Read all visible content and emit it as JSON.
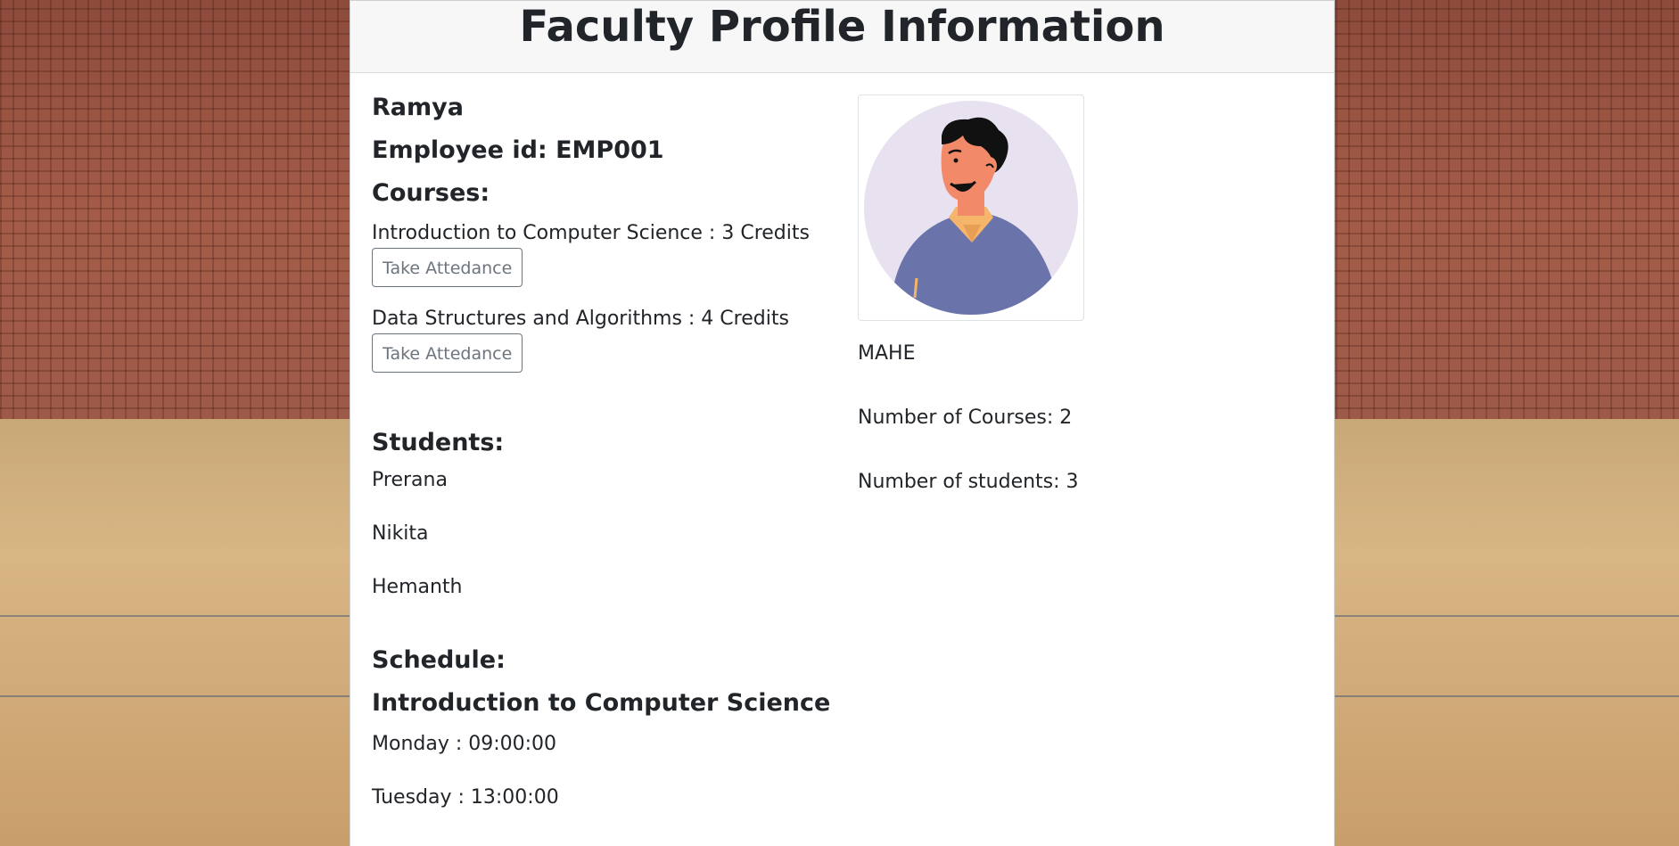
{
  "header": {
    "title": "Faculty Profile Information"
  },
  "profile": {
    "name": "Ramya",
    "employee_id": "Employee id: EMP001",
    "institution": "MAHE",
    "num_courses": "Number of Courses: 2",
    "num_students": "Number of students: 3",
    "avatar_icon": "person-avatar-icon"
  },
  "courses": {
    "heading": "Courses:",
    "items": [
      {
        "text": "Introduction to Computer Science : 3 Credits",
        "button": "Take Attedance"
      },
      {
        "text": "Data Structures and Algorithms : 4 Credits",
        "button": "Take Attedance"
      }
    ]
  },
  "students": {
    "heading": "Students:",
    "items": [
      "Prerana",
      "Nikita",
      "Hemanth"
    ]
  },
  "schedule": {
    "heading": "Schedule:",
    "course_title": "Introduction to Computer Science",
    "items": [
      "Monday : 09:00:00",
      "Tuesday : 13:00:00"
    ]
  },
  "colors": {
    "header_bg": "#f7f7f7",
    "button_border": "#6c757d",
    "avatar_bg": "#e7e1f0",
    "shirt": "#6b73ab",
    "skin": "#f28a6a",
    "collar": "#f5b56a"
  }
}
